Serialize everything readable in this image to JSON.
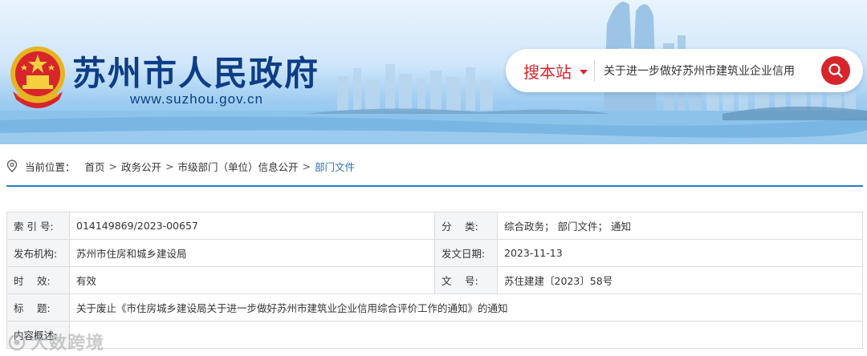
{
  "header": {
    "site_title": "苏州市人民政府",
    "site_url": "www.suzhou.gov.cn"
  },
  "search": {
    "scope": "搜本站",
    "query": "关于进一步做好苏州市建筑业企业信用"
  },
  "breadcrumb": {
    "prefix": "当前位置：",
    "items": [
      "首页",
      "政务公开",
      "市级部门（单位）信息公开",
      "部门文件"
    ],
    "separator": ">"
  },
  "info": {
    "index_label": "索 引 号:",
    "index_value": "014149869/2023-00657",
    "category_label": "分　 类:",
    "category_value": "综合政务；  部门文件；  通知",
    "publisher_label": "发布机构:",
    "publisher_value": "苏州市住房和城乡建设局",
    "date_label": "发文日期:",
    "date_value": "2023-11-13",
    "validity_label": "时　 效:",
    "validity_value": "有效",
    "docno_label": "文　 号:",
    "docno_value": "苏住建建〔2023〕58号",
    "title_label": "标　 题:",
    "title_value": "关于废止《市住房城乡建设局关于进一步做好苏州市建筑业企业信用综合评价工作的通知》的通知",
    "summary_label": "内容概述:",
    "summary_value": ""
  },
  "watermark": {
    "text": "大数跨境"
  },
  "colors": {
    "title_blue": "#0d3d86",
    "accent_red": "#d7252c",
    "link_blue": "#2a6fb6",
    "rule_blue": "#2c78c5"
  }
}
